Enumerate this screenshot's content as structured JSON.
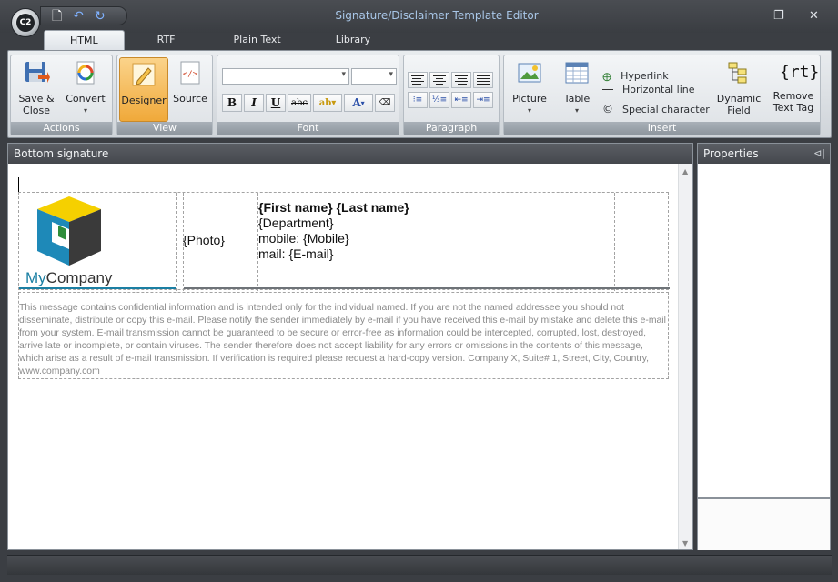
{
  "window": {
    "title": "Signature/Disclaimer Template Editor",
    "app_icon_text": "C2",
    "restore_glyph": "❐",
    "close_glyph": "✕"
  },
  "tabs": [
    {
      "label": "HTML",
      "active": true
    },
    {
      "label": "RTF"
    },
    {
      "label": "Plain Text"
    },
    {
      "label": "Library"
    }
  ],
  "ribbon": {
    "actions": {
      "label": "Actions",
      "save_close": "Save &\nClose",
      "convert": "Convert"
    },
    "view": {
      "label": "View",
      "designer": "Designer",
      "source": "Source"
    },
    "font": {
      "label": "Font",
      "bold": "B",
      "italic": "I",
      "underline": "U",
      "strike": "abc",
      "font_color": "A"
    },
    "paragraph": {
      "label": "Paragraph"
    },
    "insert": {
      "label": "Insert",
      "picture": "Picture",
      "table": "Table",
      "hyperlink": "Hyperlink",
      "horizontal_line": "Horizontal line",
      "special_character": "Special character",
      "dynamic_field": "Dynamic\nField",
      "remove_text_tag": "Remove\nText Tag",
      "rt_glyph": "{rt}"
    }
  },
  "editor": {
    "panel_title": "Bottom signature",
    "logo": {
      "my": "My",
      "company": "Company"
    },
    "photo": "{Photo}",
    "contact": {
      "name": "{First name} {Last name}",
      "department": "{Department}",
      "mobile": "mobile: {Mobile}",
      "mail": "mail: {E-mail}"
    },
    "disclaimer": "This message contains confidential information and is intended only for the individual named. If you are not the named addressee you should not disseminate, distribute or copy this e-mail. Please notify the sender immediately by e-mail if you have received this e-mail by mistake and delete this e-mail from your system. E-mail transmission cannot be guaranteed to be secure or error-free as information could be intercepted, corrupted, lost, destroyed, arrive late or incomplete, or contain viruses. The sender therefore does not accept liability for any errors or omissions in the contents of this message, which arise as a result of e-mail transmission. If verification is required please request a hard-copy version. Company X, Suite# 1, Street, City, Country, www.company.com"
  },
  "properties": {
    "title": "Properties"
  },
  "colors": {
    "accent": "#1b7fa3",
    "active_tab": "#f0a93a",
    "title_text": "#a9c7e8"
  }
}
